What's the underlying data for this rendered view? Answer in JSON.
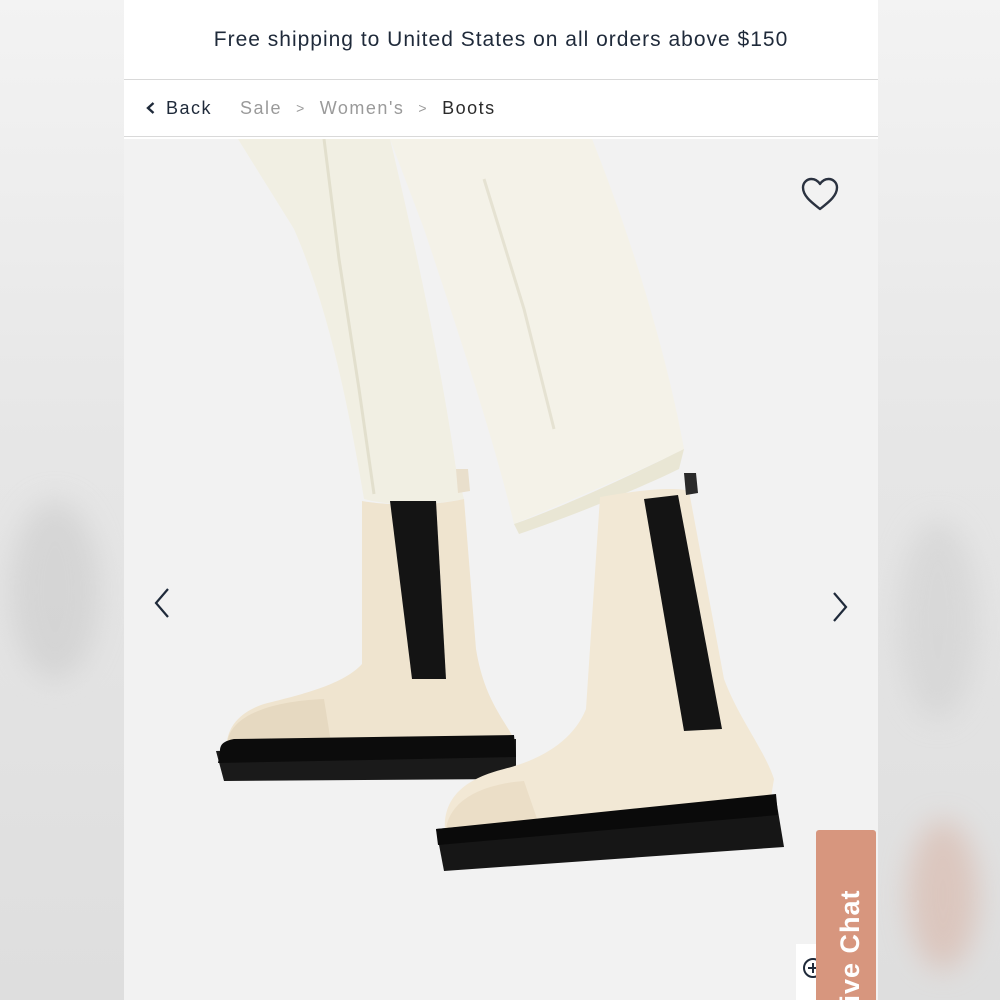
{
  "banner": {
    "text": "Free shipping to United States on all orders above $150"
  },
  "breadcrumb": {
    "back_label": "Back",
    "items": [
      "Sale",
      "Women's",
      "Boots"
    ],
    "separator": ">"
  },
  "gallery": {
    "image_subject": "cream leather chelsea boots with black elastic panels and chunky black lug soles, worn with cream cropped jeans",
    "wishlist_icon": "heart-outline-icon",
    "prev_icon": "chevron-left-icon",
    "next_icon": "chevron-right-icon",
    "zoom_icon": "zoom-in-icon"
  },
  "live_chat": {
    "label": "Live Chat",
    "color": "#d7967e"
  },
  "colors": {
    "text_dark": "#1f2a3a",
    "text_muted": "#9a9a9a",
    "divider": "#d9d9d9",
    "image_bg": "#f2f2f2"
  }
}
